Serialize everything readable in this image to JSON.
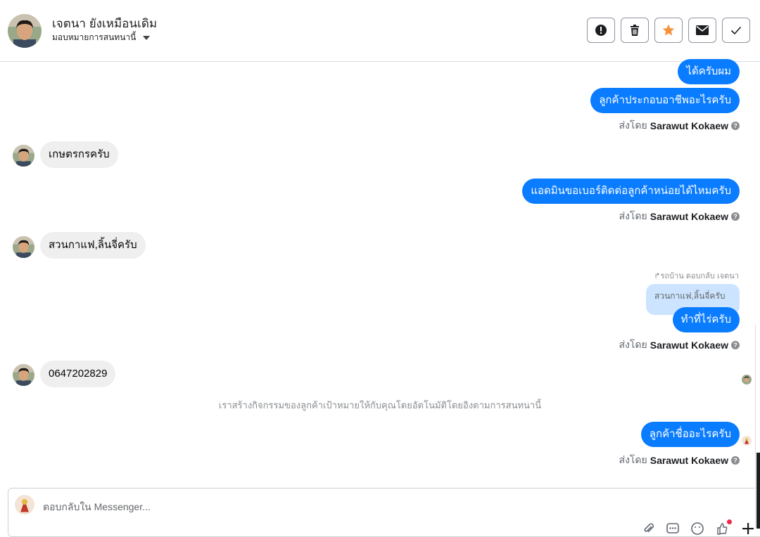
{
  "header": {
    "contact_name": "เจตนา ยังเหมือนเดิม",
    "assign_label": "มอบหมายการสนทนานี้",
    "buttons": [
      {
        "icon": "exclamation-icon",
        "color": "#1c1e21"
      },
      {
        "icon": "trash-icon",
        "color": "#1c1e21"
      },
      {
        "icon": "star-icon",
        "color": "#f7923b"
      },
      {
        "icon": "envelope-icon",
        "color": "#1c1e21"
      },
      {
        "icon": "checkmark-icon",
        "color": "#1c1e21"
      }
    ]
  },
  "messages": {
    "m1_out": "ได้ครับผม",
    "m2_out": "ลูกค้าประกอบอาชีพอะไรครับ",
    "sent_by_prefix": "ส่งโดย",
    "agent_name": "Sarawut Kokaew",
    "m3_in": "เกษตรกรครับ",
    "m4_out": "แอดมินขอเบอร์ติดต่อลูกค้าหน่อยได้ไหมครับ",
    "m5_in": "สวนกาแฟ,ลิ้นจี่ครับ",
    "reply_meta": "รถบ้าน ตอบกลับ เจตนา",
    "quoted_text": "สวนกาแฟ,ลิ้นจี่ครับ",
    "m6_out": "ทำที่ไร่ครับ",
    "m7_in": "0647202829",
    "system_note": "เราสร้างกิจกรรมของลูกค้าเป้าหมายให้กับคุณโดยอัตโนมัติโดยอิงตามการสนทนานี้",
    "m8_out": "ลูกค้าชื่ออะไรครับ"
  },
  "composer": {
    "placeholder": "ตอบกลับใน Messenger..."
  },
  "colors": {
    "outgoing_bubble": "#0a7cff",
    "incoming_bubble": "#efefef",
    "quoted_bubble": "#cce4ff",
    "star": "#f7923b"
  }
}
